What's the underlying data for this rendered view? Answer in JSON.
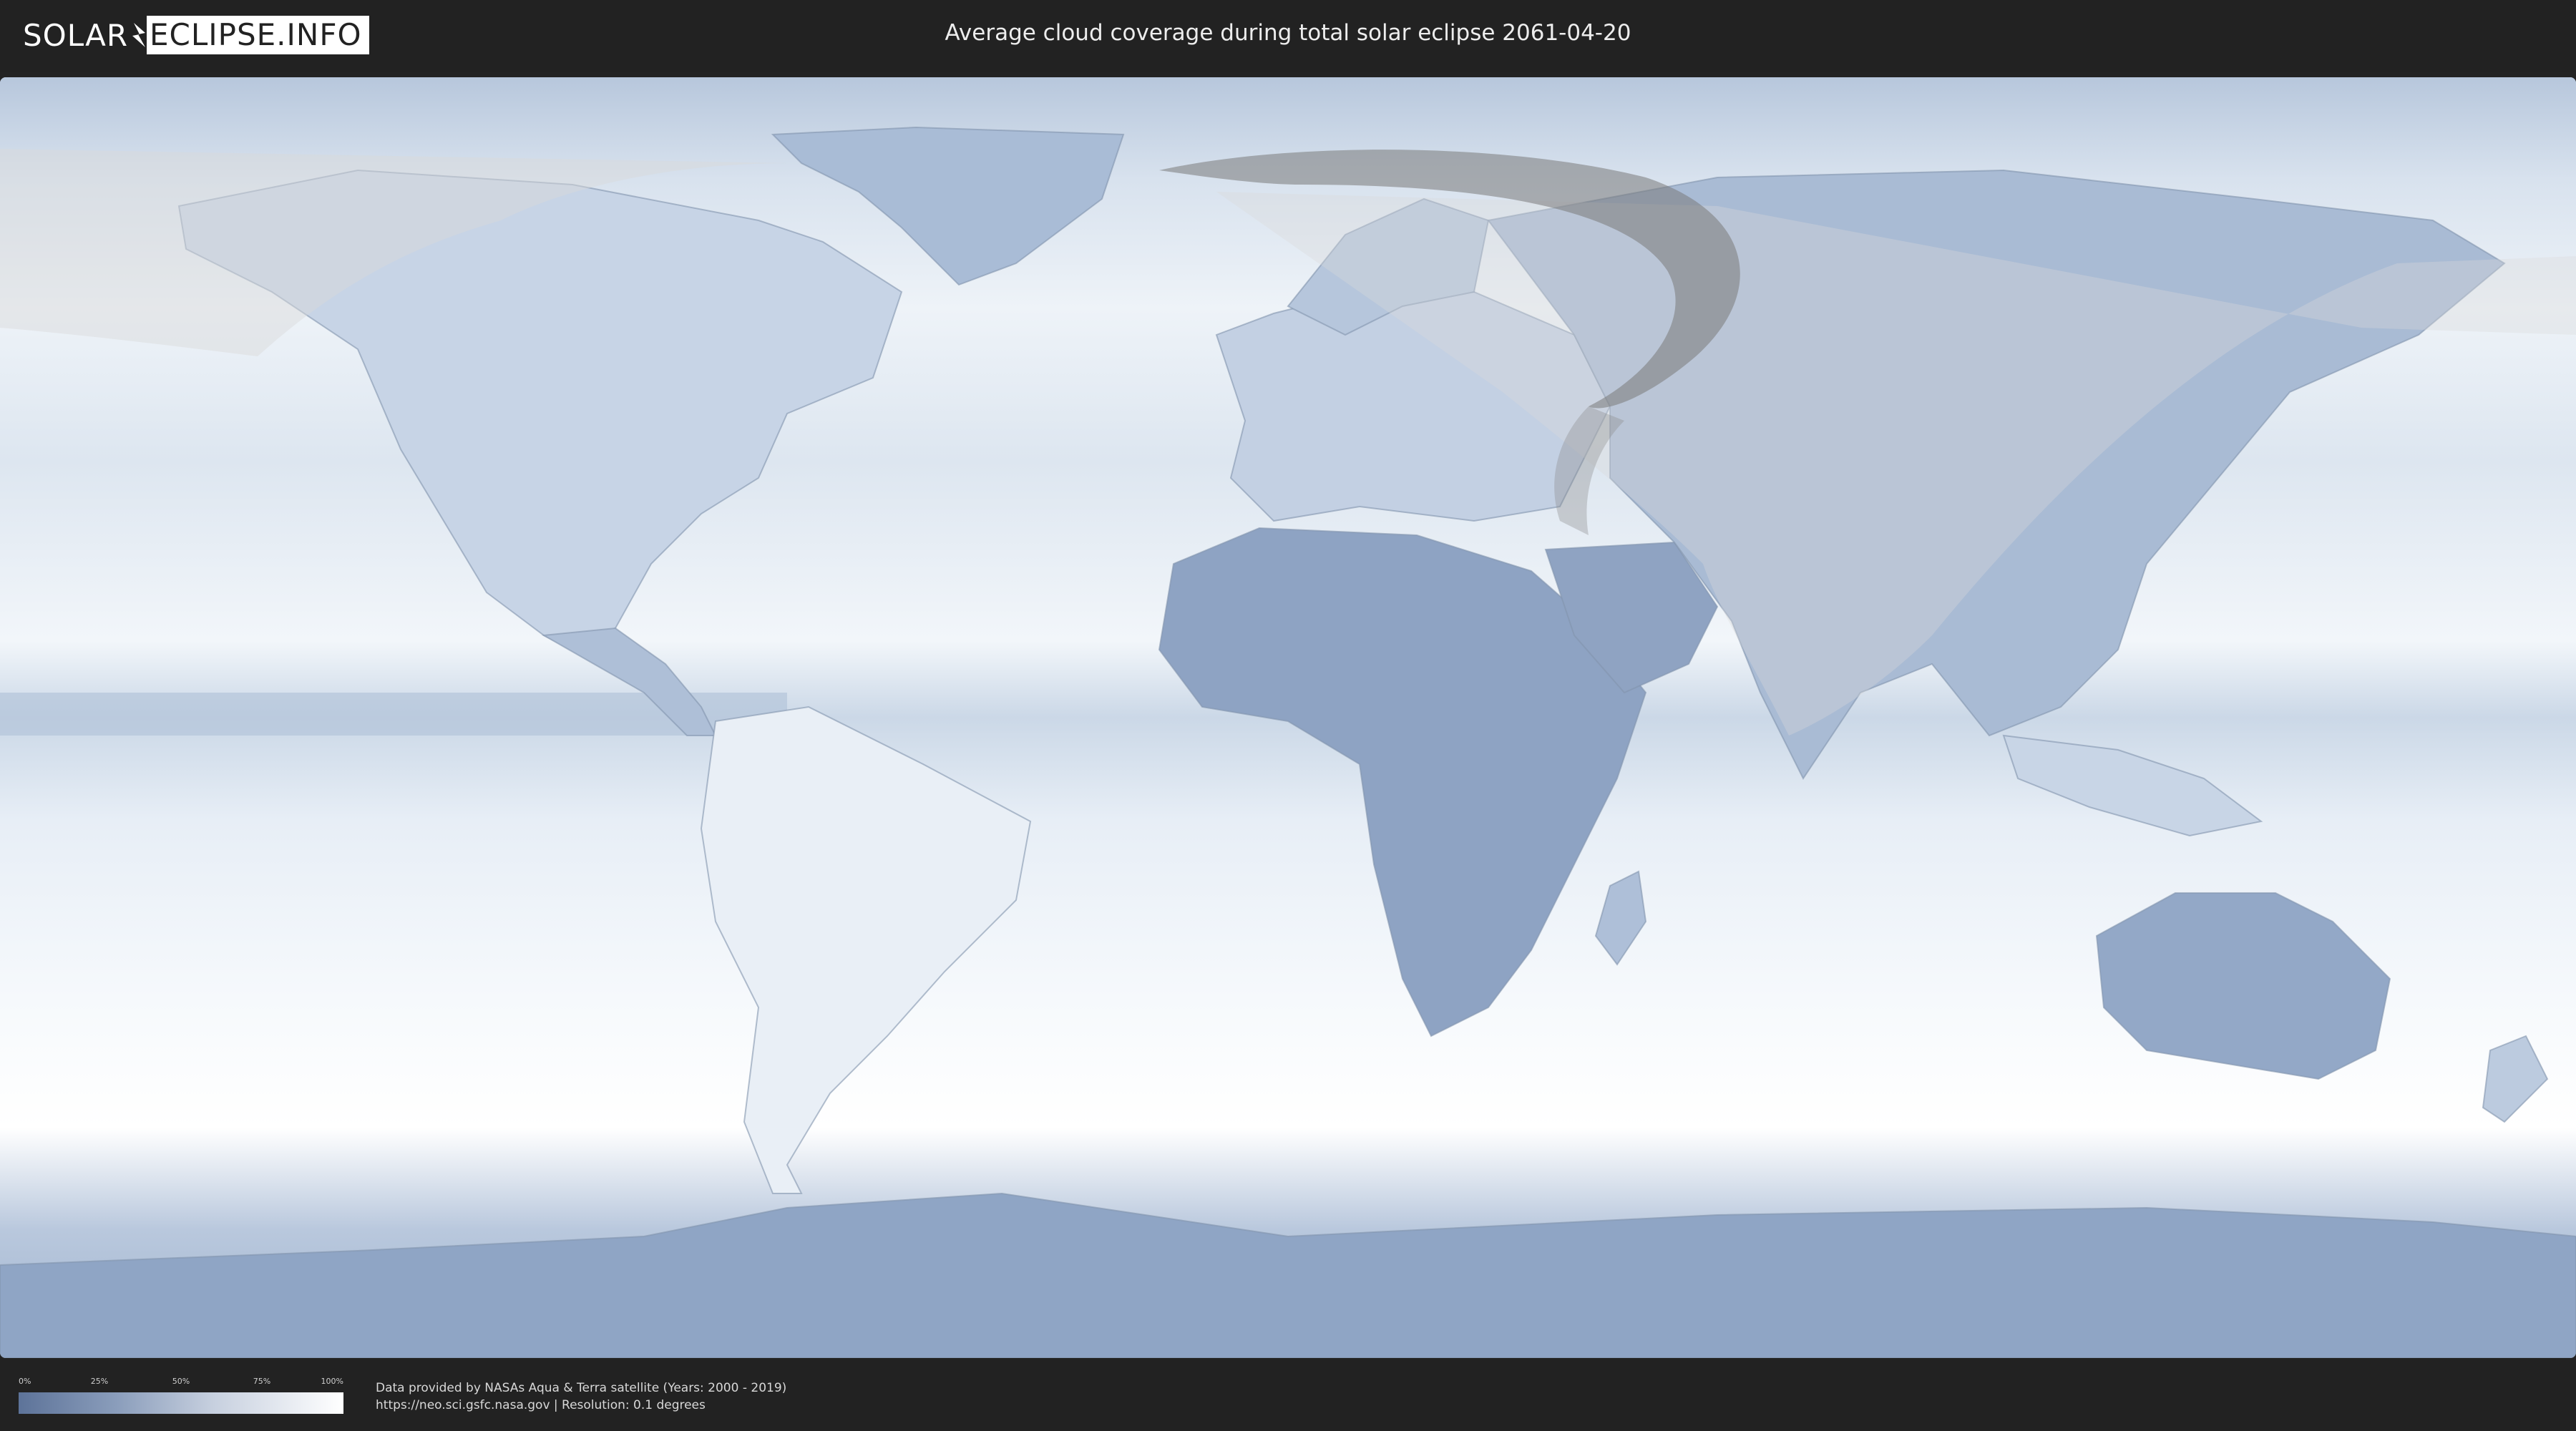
{
  "header": {
    "logo_part1": "SOLAR",
    "logo_part2": "ECLIPSE.INFO",
    "title": "Average cloud coverage during total solar eclipse 2061-04-20"
  },
  "legend": {
    "ticks": [
      "0%",
      "25%",
      "50%",
      "75%",
      "100%"
    ],
    "scale_colors": [
      "#5d7399",
      "#8a9dbb",
      "#c7d0df",
      "#ffffff"
    ]
  },
  "footer": {
    "source_line1": "Data provided by NASAs Aqua & Terra satellite (Years: 2000 - 2019)",
    "source_line2": "https://neo.sci.gsfc.nasa.gov | Resolution: 0.1 degrees"
  },
  "map": {
    "projection": "equirectangular",
    "cloud_low_color": "#6a82a8",
    "cloud_high_color": "#ffffff",
    "visibility_overlay_color": "#d9d9d9",
    "totality_path_color": "#7a7a7a"
  }
}
